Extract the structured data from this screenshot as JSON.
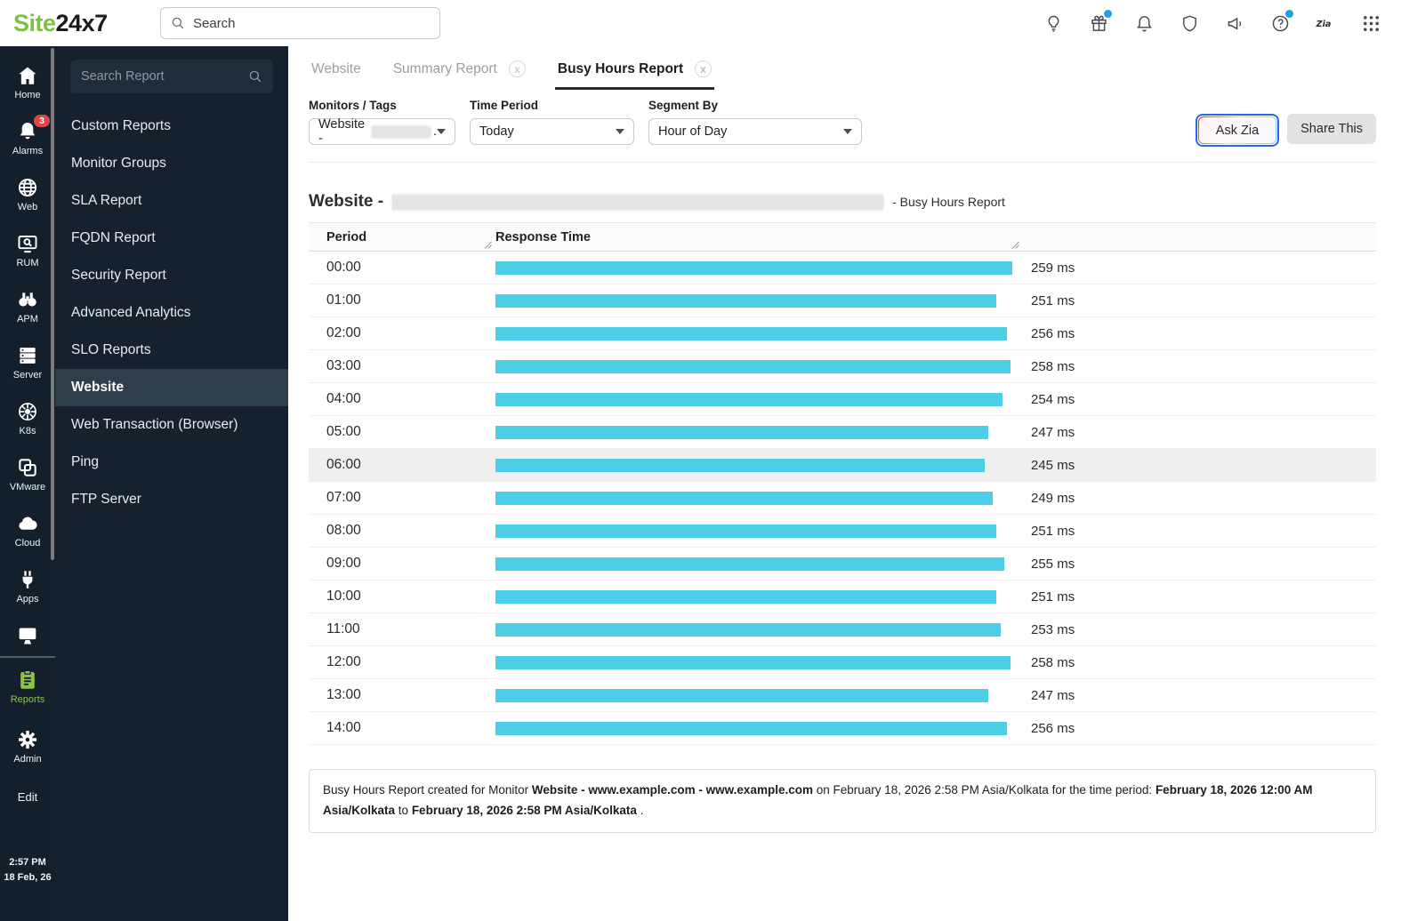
{
  "header": {
    "logo_green": "Site",
    "logo_dark": "24x7",
    "search_placeholder": "Search",
    "badge_color": "#1f9fe8",
    "icons": [
      {
        "name": "lightbulb",
        "badge": false
      },
      {
        "name": "gift",
        "badge": true
      },
      {
        "name": "bell",
        "badge": false
      },
      {
        "name": "shield",
        "badge": false
      },
      {
        "name": "megaphone",
        "badge": false
      },
      {
        "name": "help",
        "badge": true
      },
      {
        "name": "zia",
        "badge": false
      },
      {
        "name": "apps-grid",
        "badge": false
      }
    ]
  },
  "rail": {
    "badge_color": "#e14544",
    "active_color": "#8bc34a",
    "items": [
      {
        "label": "Home",
        "icon": "home"
      },
      {
        "label": "Alarms",
        "icon": "bell",
        "badge": "3"
      },
      {
        "label": "Web",
        "icon": "globe"
      },
      {
        "label": "RUM",
        "icon": "rum"
      },
      {
        "label": "APM",
        "icon": "binoculars"
      },
      {
        "label": "Server",
        "icon": "server"
      },
      {
        "label": "K8s",
        "icon": "k8s"
      },
      {
        "label": "VMware",
        "icon": "vmware"
      },
      {
        "label": "Cloud",
        "icon": "cloud"
      },
      {
        "label": "Apps",
        "icon": "plug"
      },
      {
        "label": "",
        "icon": "desktop"
      }
    ],
    "bottom_items": [
      {
        "label": "Reports",
        "icon": "clipboard",
        "active": true
      },
      {
        "label": "Admin",
        "icon": "gear",
        "active": false
      },
      {
        "label": "Edit",
        "icon": null,
        "active": false
      }
    ],
    "time": "2:57 PM",
    "date": "18 Feb, 26"
  },
  "report_nav": {
    "search_placeholder": "Search Report",
    "active_item": "Website",
    "items": [
      "Custom Reports",
      "Monitor Groups",
      "SLA Report",
      "FQDN Report",
      "Security Report",
      "Advanced Analytics",
      "SLO Reports",
      "Website",
      "Web Transaction (Browser)",
      "Ping",
      "FTP Server"
    ]
  },
  "tabs": [
    {
      "label": "Website",
      "closable": false,
      "active": false
    },
    {
      "label": "Summary Report",
      "closable": true,
      "active": false
    },
    {
      "label": "Busy Hours Report",
      "closable": true,
      "active": true
    }
  ],
  "filters": [
    {
      "label": "Monitors / Tags",
      "value": "Website -",
      "redacted": true,
      "redacted_suffix": "."
    },
    {
      "label": "Time Period",
      "value": "Today",
      "redacted": false
    },
    {
      "label": "Segment By",
      "value": "Hour of Day",
      "redacted": false
    }
  ],
  "actions": {
    "ask_zia": "Ask Zia",
    "share_this": "Share This"
  },
  "report_title": {
    "prefix": "Website -",
    "redacted": true,
    "suffix": "- Busy Hours Report"
  },
  "chart_data": {
    "type": "bar",
    "title": "Website - Busy Hours Report",
    "columns": [
      "Period",
      "Response Time"
    ],
    "categories": [
      "00:00",
      "01:00",
      "02:00",
      "03:00",
      "04:00",
      "05:00",
      "06:00",
      "07:00",
      "08:00",
      "09:00",
      "10:00",
      "11:00",
      "12:00",
      "13:00",
      "14:00"
    ],
    "values": [
      259,
      251,
      256,
      258,
      254,
      247,
      245,
      249,
      251,
      255,
      251,
      253,
      258,
      247,
      256
    ],
    "unit": "ms",
    "bar_color": "#4ccfe6",
    "highlighted_row": "06:00",
    "xlim": [
      0,
      259
    ],
    "orientation": "horizontal",
    "grid": false,
    "legend": false
  },
  "footer_note": {
    "segments": [
      {
        "text": "Busy Hours Report created for Monitor ",
        "bold": false
      },
      {
        "text": "Website - www.example.com - www.example.com",
        "bold": true
      },
      {
        "text": " on February 18, 2026 2:58 PM Asia/Kolkata for the time period: ",
        "bold": false
      },
      {
        "text": "February 18, 2026 12:00 AM Asia/Kolkata",
        "bold": true
      },
      {
        "text": " to ",
        "bold": false
      },
      {
        "text": "February 18, 2026 2:58 PM Asia/Kolkata",
        "bold": true
      },
      {
        "text": " .",
        "bold": false
      }
    ]
  }
}
